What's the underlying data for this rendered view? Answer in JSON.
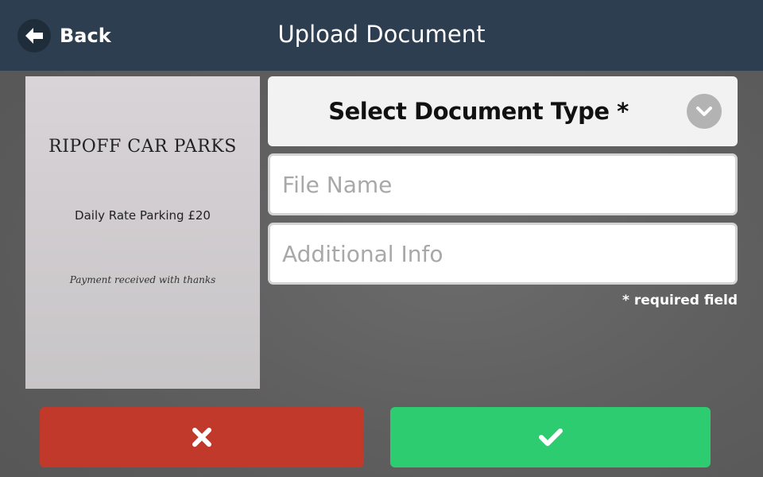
{
  "header": {
    "back_label": "Back",
    "title": "Upload Document",
    "back_icon": "arrow-left-icon",
    "background": "#2d3e50"
  },
  "preview": {
    "document_title": "RIPOFF CAR PARKS",
    "document_line": "Daily Rate Parking £20",
    "document_footer": "Payment received with thanks"
  },
  "form": {
    "select_label": "Select Document Type *",
    "select_icon": "chevron-down-icon",
    "file_name": {
      "value": "",
      "placeholder": "File Name"
    },
    "additional_info": {
      "value": "",
      "placeholder": "Additional Info"
    },
    "required_note": "* required field"
  },
  "actions": {
    "cancel_icon": "close-icon",
    "cancel_color": "#c0392b",
    "confirm_icon": "check-icon",
    "confirm_color": "#2ecc71"
  }
}
